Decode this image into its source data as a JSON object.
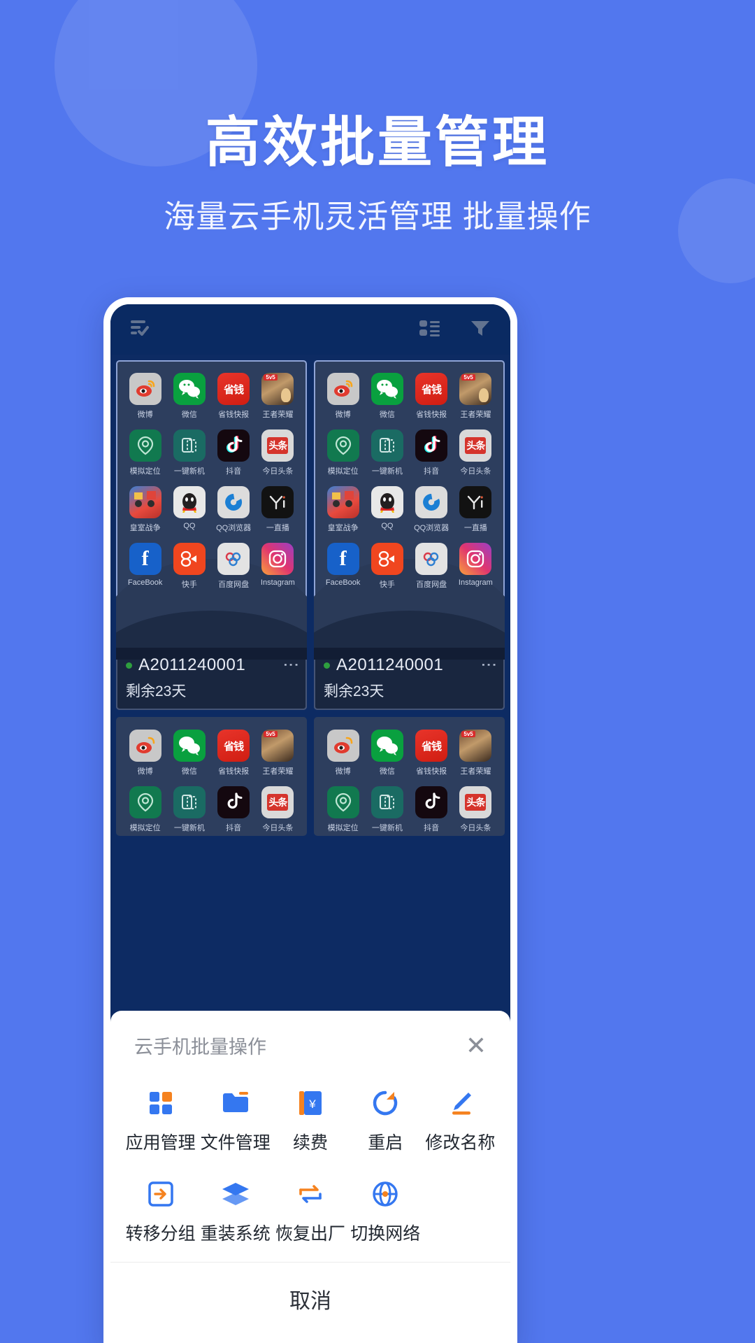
{
  "hero": {
    "title": "高效批量管理",
    "subtitle": "海量云手机灵活管理 批量操作"
  },
  "colors": {
    "background": "#5277ee",
    "phone_screen": "#0d2b63",
    "appbar": "#0a2a62",
    "card": "#2d3e5e",
    "accent_blue": "#3477f0",
    "accent_orange": "#f5821f",
    "status_online": "#2e9e3f"
  },
  "appbar": {
    "icons": [
      {
        "name": "checklist-icon",
        "position": "left"
      },
      {
        "name": "list-view-icon",
        "position": "right"
      },
      {
        "name": "filter-icon",
        "position": "right"
      }
    ]
  },
  "apps": [
    {
      "label": "微博",
      "icon": "weibo-icon"
    },
    {
      "label": "微信",
      "icon": "wechat-icon"
    },
    {
      "label": "省钱快报",
      "icon": "shengqian-icon"
    },
    {
      "label": "王者荣耀",
      "icon": "honorofkings-icon"
    },
    {
      "label": "模拟定位",
      "icon": "location-icon"
    },
    {
      "label": "一键新机",
      "icon": "newphone-icon"
    },
    {
      "label": "抖音",
      "icon": "douyin-icon"
    },
    {
      "label": "今日头条",
      "icon": "toutiao-icon"
    },
    {
      "label": "皇室战争",
      "icon": "clashroyale-icon"
    },
    {
      "label": "QQ",
      "icon": "qq-icon"
    },
    {
      "label": "QQ浏览器",
      "icon": "qqbrowser-icon"
    },
    {
      "label": "一直播",
      "icon": "yizhibo-icon"
    },
    {
      "label": "FaceBook",
      "icon": "facebook-icon"
    },
    {
      "label": "快手",
      "icon": "kuaishou-icon"
    },
    {
      "label": "百度网盘",
      "icon": "baiduyun-icon"
    },
    {
      "label": "Instagram",
      "icon": "instagram-icon"
    }
  ],
  "devices": [
    {
      "name": "A2011240001",
      "status": "online",
      "expiry": "剩余23天",
      "more": "⋮"
    },
    {
      "name": "A2011240001",
      "status": "online",
      "expiry": "剩余23天",
      "more": "⋮"
    }
  ],
  "sheet": {
    "title": "云手机批量操作",
    "close": "✕",
    "actions": [
      {
        "label": "应用管理",
        "icon": "app-manage-icon"
      },
      {
        "label": "文件管理",
        "icon": "file-manage-icon"
      },
      {
        "label": "续费",
        "icon": "renew-icon"
      },
      {
        "label": "重启",
        "icon": "restart-icon"
      },
      {
        "label": "修改名称",
        "icon": "rename-icon"
      },
      {
        "label": "转移分组",
        "icon": "move-group-icon"
      },
      {
        "label": "重装系统",
        "icon": "reinstall-icon"
      },
      {
        "label": "恢复出厂",
        "icon": "factory-reset-icon"
      },
      {
        "label": "切换网络",
        "icon": "switch-network-icon"
      }
    ],
    "cancel": "取消"
  }
}
